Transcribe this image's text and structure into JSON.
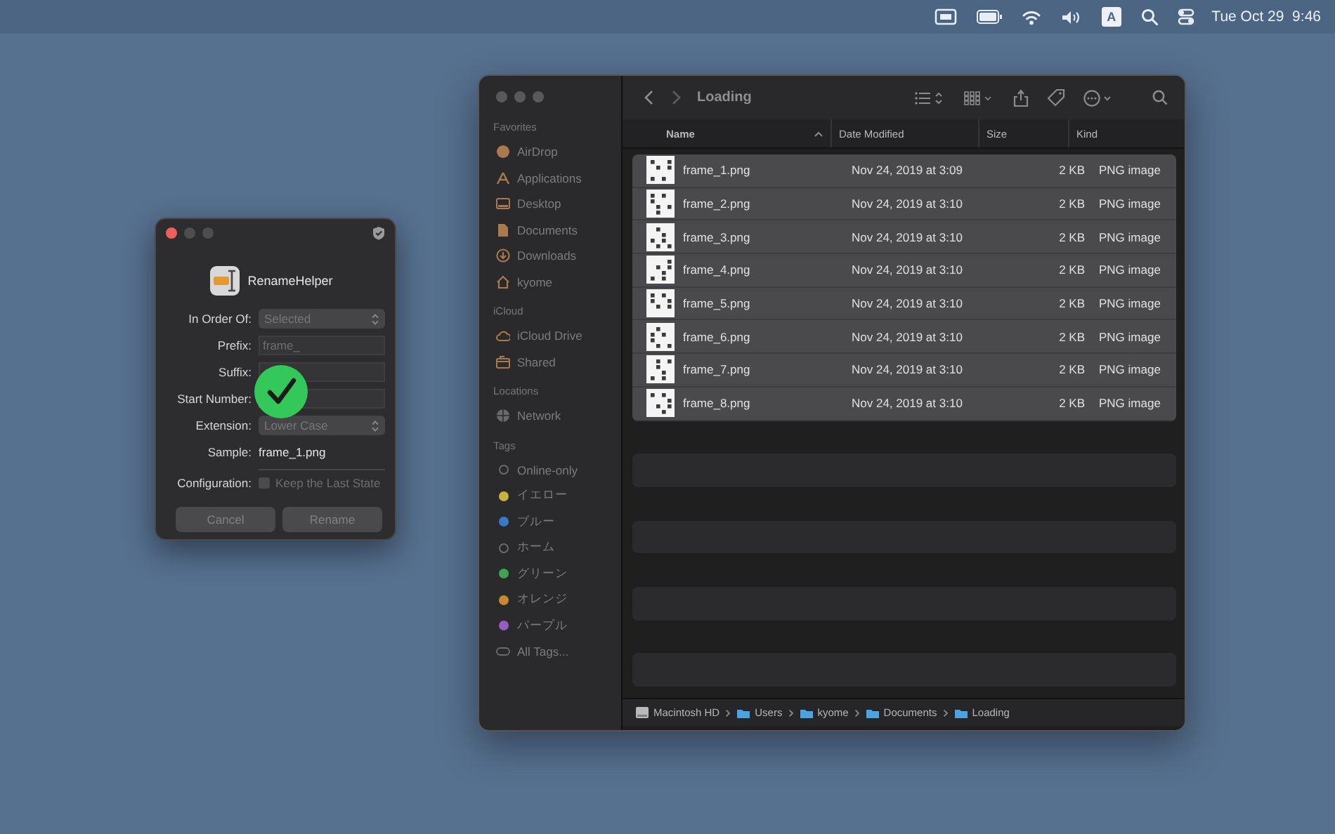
{
  "menu_bar": {
    "input_source": "A",
    "clock": "Tue Oct 29  9:46"
  },
  "dialog": {
    "app_name": "RenameHelper",
    "fields": [
      {
        "kind": "popup",
        "label": "In Order Of:",
        "value": "Selected"
      },
      {
        "kind": "text",
        "label": "Prefix:",
        "placeholder": "frame_"
      },
      {
        "kind": "text",
        "label": "Suffix:"
      },
      {
        "kind": "text",
        "label": "Start Number:"
      },
      {
        "kind": "popup",
        "label": "Extension:",
        "value": "Lower Case"
      },
      {
        "kind": "sample",
        "label": "Sample:",
        "value": "frame_1.png"
      },
      {
        "kind": "checkbox",
        "label": "Configuration:",
        "value": "Keep the Last State",
        "checked": false
      }
    ],
    "buttons": [
      "Cancel",
      "Rename"
    ],
    "success_badge": true
  },
  "finder": {
    "title": "Loading",
    "sidebar": [
      {
        "heading": "Favorites",
        "items": [
          {
            "kind": "airdrop",
            "label": "AirDrop"
          },
          {
            "kind": "apps",
            "label": "Applications"
          },
          {
            "kind": "desktop",
            "label": "Desktop"
          },
          {
            "kind": "doc",
            "label": "Documents"
          },
          {
            "kind": "download",
            "label": "Downloads"
          },
          {
            "kind": "home",
            "label": "kyome"
          }
        ]
      },
      {
        "heading": "iCloud",
        "items": [
          {
            "kind": "cloud",
            "label": "iCloud Drive"
          },
          {
            "kind": "shared",
            "label": "Shared"
          }
        ]
      },
      {
        "heading": "Locations",
        "items": [
          {
            "kind": "network",
            "label": "Network"
          }
        ]
      },
      {
        "heading": "Tags",
        "items": [
          {
            "kind": "tag",
            "label": "Online-only"
          },
          {
            "kind": "tag",
            "label": "イエロー",
            "color": "#c7b43c"
          },
          {
            "kind": "tag",
            "label": "ブルー",
            "color": "#3a78c8"
          },
          {
            "kind": "tag",
            "label": "ホーム"
          },
          {
            "kind": "tag",
            "label": "グリーン",
            "color": "#3fa34f"
          },
          {
            "kind": "tag",
            "label": "オレンジ",
            "color": "#c58b2e"
          },
          {
            "kind": "tag",
            "label": "パープル",
            "color": "#9a5bc2"
          },
          {
            "kind": "alltags",
            "label": "All Tags..."
          }
        ]
      }
    ],
    "columns": [
      "Name",
      "Date Modified",
      "Size",
      "Kind"
    ],
    "rows": [
      {
        "name": "frame_1.png",
        "date": "Nov 24, 2019 at 3:09",
        "size": "2 KB",
        "kind": "PNG image",
        "selected": true
      },
      {
        "name": "frame_2.png",
        "date": "Nov 24, 2019 at 3:10",
        "size": "2 KB",
        "kind": "PNG image",
        "selected": true
      },
      {
        "name": "frame_3.png",
        "date": "Nov 24, 2019 at 3:10",
        "size": "2 KB",
        "kind": "PNG image",
        "selected": true
      },
      {
        "name": "frame_4.png",
        "date": "Nov 24, 2019 at 3:10",
        "size": "2 KB",
        "kind": "PNG image",
        "selected": true
      },
      {
        "name": "frame_5.png",
        "date": "Nov 24, 2019 at 3:10",
        "size": "2 KB",
        "kind": "PNG image",
        "selected": true
      },
      {
        "name": "frame_6.png",
        "date": "Nov 24, 2019 at 3:10",
        "size": "2 KB",
        "kind": "PNG image",
        "selected": true
      },
      {
        "name": "frame_7.png",
        "date": "Nov 24, 2019 at 3:10",
        "size": "2 KB",
        "kind": "PNG image",
        "selected": true
      },
      {
        "name": "frame_8.png",
        "date": "Nov 24, 2019 at 3:10",
        "size": "2 KB",
        "kind": "PNG image",
        "selected": true
      }
    ],
    "path": [
      {
        "kind": "disk",
        "label": "Macintosh HD"
      },
      {
        "kind": "folder",
        "label": "Users"
      },
      {
        "kind": "folder",
        "label": "kyome"
      },
      {
        "kind": "folder",
        "label": "Documents"
      },
      {
        "kind": "folder",
        "label": "Loading"
      }
    ]
  }
}
